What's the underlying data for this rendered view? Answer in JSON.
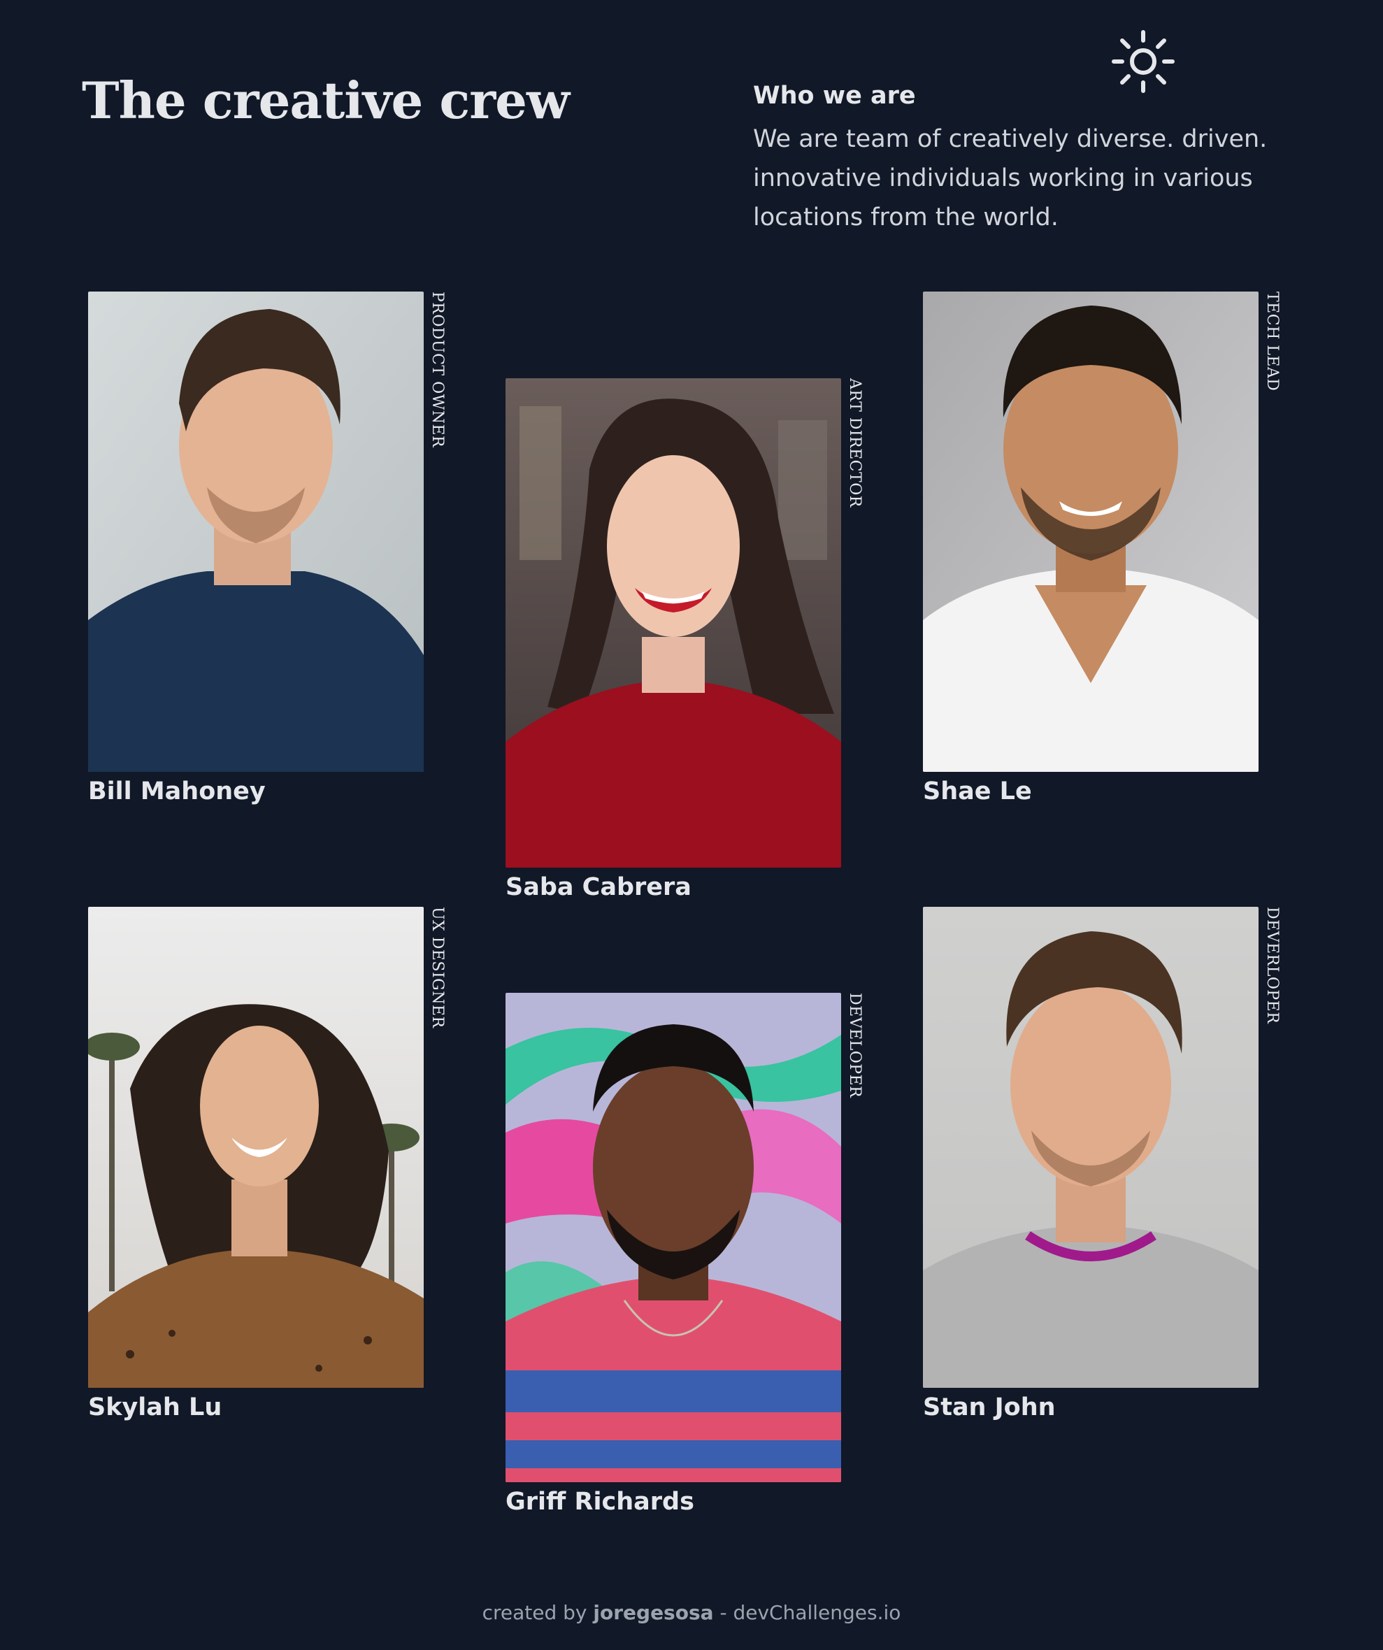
{
  "header": {
    "title": "The creative crew",
    "theme_toggle_icon": "sun-icon"
  },
  "about": {
    "heading": "Who we are",
    "text": "We are team of creatively diverse. driven. innovative individuals working in various locations from the world."
  },
  "members": [
    {
      "name": "Bill Mahoney",
      "role": "PRODUCT OWNER"
    },
    {
      "name": "Saba Cabrera",
      "role": "ART DIRECTOR"
    },
    {
      "name": "Shae Le",
      "role": "TECH LEAD"
    },
    {
      "name": "Skylah Lu",
      "role": "UX DESIGNER"
    },
    {
      "name": "Griff Richards",
      "role": "DEVELOPER"
    },
    {
      "name": "Stan John",
      "role": "DEVERLOPER"
    }
  ],
  "footer": {
    "prefix": "created by",
    "author": "joregesosa",
    "separator": "-",
    "site": "devChallenges.io"
  },
  "colors": {
    "background": "#111827",
    "text": "#e5e7eb",
    "muted": "#9ca3af"
  }
}
